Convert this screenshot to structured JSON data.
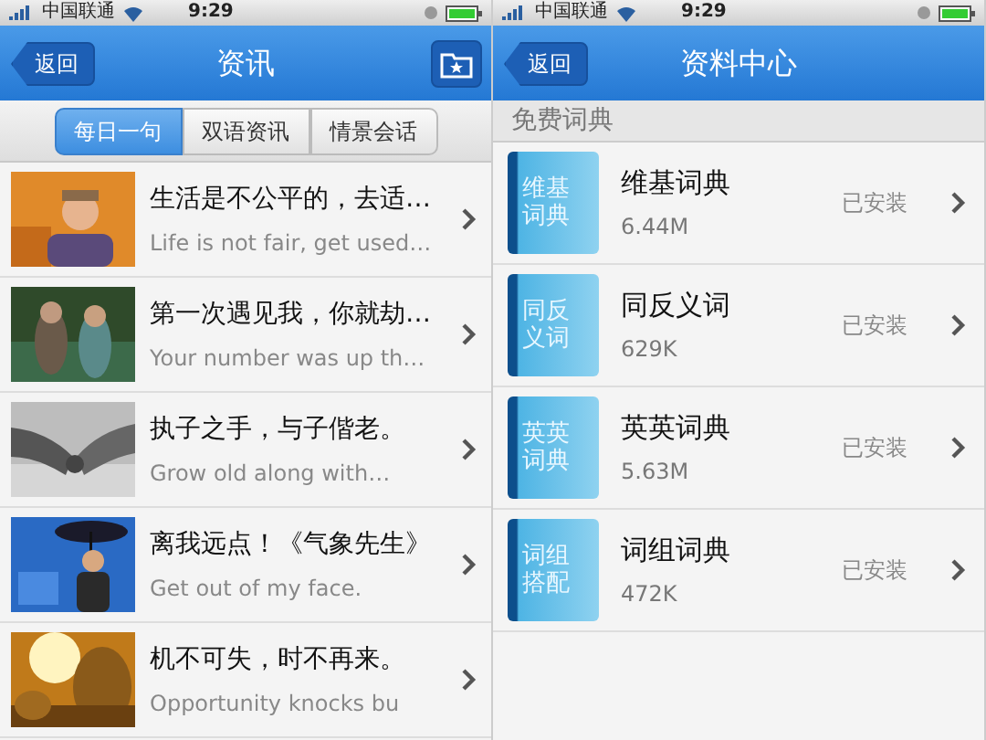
{
  "screens": [
    {
      "status_bar": {
        "carrier": "中国联通",
        "time": "9:29"
      },
      "nav": {
        "back": "返回",
        "title": "资讯",
        "right_button": {
          "kind": "favorites"
        }
      },
      "segments": [
        {
          "label": "每日一句",
          "selected": true
        },
        {
          "label": "双语资讯",
          "selected": false
        },
        {
          "label": "情景会话",
          "selected": false
        }
      ],
      "articles": [
        {
          "title": "生活是不公平的，去适…",
          "subtitle": "Life is not fair, get used…",
          "kind": "picture"
        },
        {
          "title": "第一次遇见我，你就劫…",
          "subtitle": "Your number was up th…",
          "kind": "picture"
        },
        {
          "title": "执子之手，与子偕老。",
          "subtitle": "Grow old along with…",
          "kind": "picture"
        },
        {
          "title": "离我远点！《气象先生》",
          "subtitle": "Get out of my face.",
          "kind": "picture"
        },
        {
          "title": "机不可失，时不再来。",
          "subtitle": "Opportunity knocks bu",
          "kind": "picture"
        }
      ]
    },
    {
      "status_bar": {
        "carrier": "中国联通",
        "time": "9:29"
      },
      "nav": {
        "back": "返回",
        "title": "资料中心"
      },
      "section": "免费词典",
      "dictionaries": [
        {
          "icon_text": [
            "维基",
            "词典"
          ],
          "name": "维基词典",
          "size": "6.44M",
          "status": "已安装"
        },
        {
          "icon_text": [
            "同反",
            "义词"
          ],
          "name": "同反义词",
          "size": "629K",
          "status": "已安装"
        },
        {
          "icon_text": [
            "英英",
            "词典"
          ],
          "name": "英英词典",
          "size": "5.63M",
          "status": "已安装"
        },
        {
          "icon_text": [
            "词组",
            "搭配"
          ],
          "name": "词组词典",
          "size": "472K",
          "status": "已安装"
        }
      ]
    }
  ]
}
